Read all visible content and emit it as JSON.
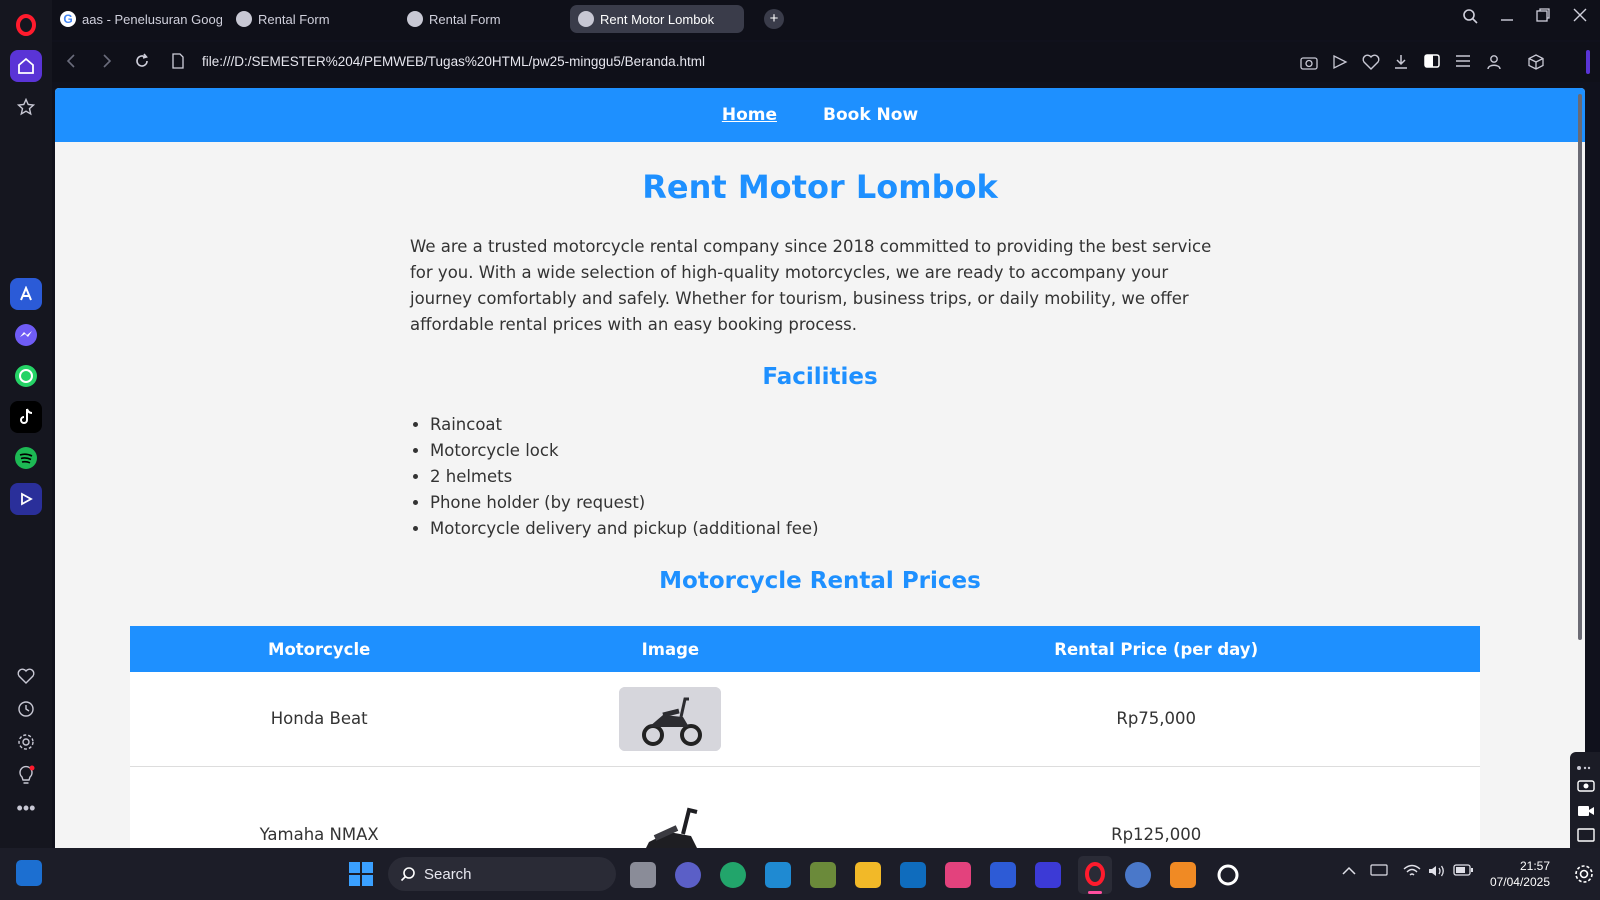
{
  "browser": {
    "tabs": [
      {
        "label": "aas - Penelusuran Google",
        "favicon": "google-icon"
      },
      {
        "label": "Rental Form",
        "favicon": "globe-icon"
      },
      {
        "label": "Rental Form",
        "favicon": "globe-icon"
      },
      {
        "label": "Rent Motor Lombok",
        "favicon": "globe-icon",
        "active": true
      }
    ],
    "url": "file:///D:/SEMESTER%204/PEMWEB/Tugas%20HTML/pw25-minggu5/Beranda.html"
  },
  "page": {
    "nav": {
      "home": "Home",
      "book": "Book Now"
    },
    "title": "Rent Motor Lombok",
    "intro": "We are a trusted motorcycle rental company since 2018 committed to providing the best service for you. With a wide selection of high-quality motorcycles, we are ready to accompany your journey comfortably and safely. Whether for tourism, business trips, or daily mobility, we offer affordable rental prices with an easy booking process.",
    "facilities_title": "Facilities",
    "facilities": [
      "Raincoat",
      "Motorcycle lock",
      "2 helmets",
      "Phone holder (by request)",
      "Motorcycle delivery and pickup (additional fee)"
    ],
    "prices_title": "Motorcycle Rental Prices",
    "table": {
      "headers": [
        "Motorcycle",
        "Image",
        "Rental Price (per day)"
      ],
      "rows": [
        {
          "name": "Honda Beat",
          "price": "Rp75,000"
        },
        {
          "name": "Yamaha NMAX",
          "price": "Rp125,000"
        }
      ]
    }
  },
  "taskbar": {
    "search": "Search",
    "time": "21:57",
    "date": "07/04/2025"
  },
  "colors": {
    "accent": "#1e90ff",
    "opera_red": "#ff1b2d",
    "chrome_bg": "#0f1019"
  }
}
